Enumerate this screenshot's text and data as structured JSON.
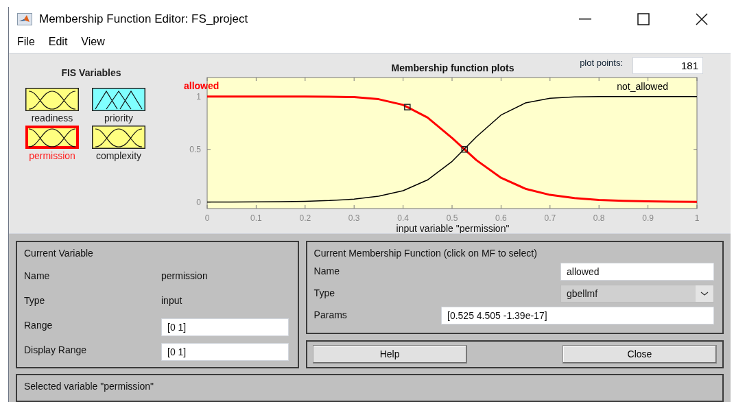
{
  "window": {
    "title": "Membership Function Editor: FS_project"
  },
  "menu": [
    "File",
    "Edit",
    "View"
  ],
  "fis_variables": {
    "title": "FIS Variables",
    "items": [
      {
        "name": "readiness",
        "kind": "bell",
        "color": "#ffff80",
        "selected": false
      },
      {
        "name": "priority",
        "kind": "triangle",
        "color": "#80ffff",
        "selected": false
      },
      {
        "name": "permission",
        "kind": "bell",
        "color": "#ffff80",
        "selected": true
      },
      {
        "name": "complexity",
        "kind": "bell",
        "color": "#ffff80",
        "selected": false
      }
    ]
  },
  "plot": {
    "plot_points_label": "plot points:",
    "plot_points": "181",
    "chart_data": {
      "type": "line",
      "title": "Membership function plots",
      "xlabel": "input variable \"permission\"",
      "x": [
        0,
        0.05,
        0.1,
        0.15,
        0.2,
        0.25,
        0.3,
        0.35,
        0.4,
        0.45,
        0.5,
        0.55,
        0.6,
        0.65,
        0.7,
        0.75,
        0.8,
        0.85,
        0.9,
        0.95,
        1
      ],
      "series": [
        {
          "name": "allowed",
          "color": "#ff0000",
          "values": [
            1,
            1,
            1,
            1,
            1,
            0.999,
            0.994,
            0.975,
            0.921,
            0.801,
            0.608,
            0.397,
            0.231,
            0.127,
            0.069,
            0.039,
            0.022,
            0.013,
            0.008,
            0.005,
            0.003
          ]
        },
        {
          "name": "not_allowed",
          "color": "#000000",
          "values": [
            0.001,
            0.002,
            0.003,
            0.005,
            0.009,
            0.016,
            0.029,
            0.056,
            0.109,
            0.211,
            0.386,
            0.62,
            0.825,
            0.94,
            0.984,
            0.997,
            1,
            1,
            1,
            1,
            1
          ]
        }
      ],
      "xlim": [
        0,
        1
      ],
      "ylim": [
        -0.06,
        1.18
      ],
      "xticks": [
        0,
        0.1,
        0.2,
        0.3,
        0.4,
        0.5,
        0.6,
        0.7,
        0.8,
        0.9,
        1
      ],
      "yticks": [
        0,
        0.5,
        1
      ]
    }
  },
  "current_variable": {
    "title": "Current Variable",
    "name_label": "Name",
    "name": "permission",
    "type_label": "Type",
    "type": "input",
    "range_label": "Range",
    "range": "[0 1]",
    "display_range_label": "Display Range",
    "display_range": "[0 1]"
  },
  "current_mf": {
    "title": "Current Membership Function (click on MF to select)",
    "name_label": "Name",
    "name": "allowed",
    "type_label": "Type",
    "type": "gbellmf",
    "params_label": "Params",
    "params": "[0.525 4.505 -1.39e-17]"
  },
  "buttons": [
    "Help",
    "Close"
  ],
  "status": "Selected variable \"permission\""
}
